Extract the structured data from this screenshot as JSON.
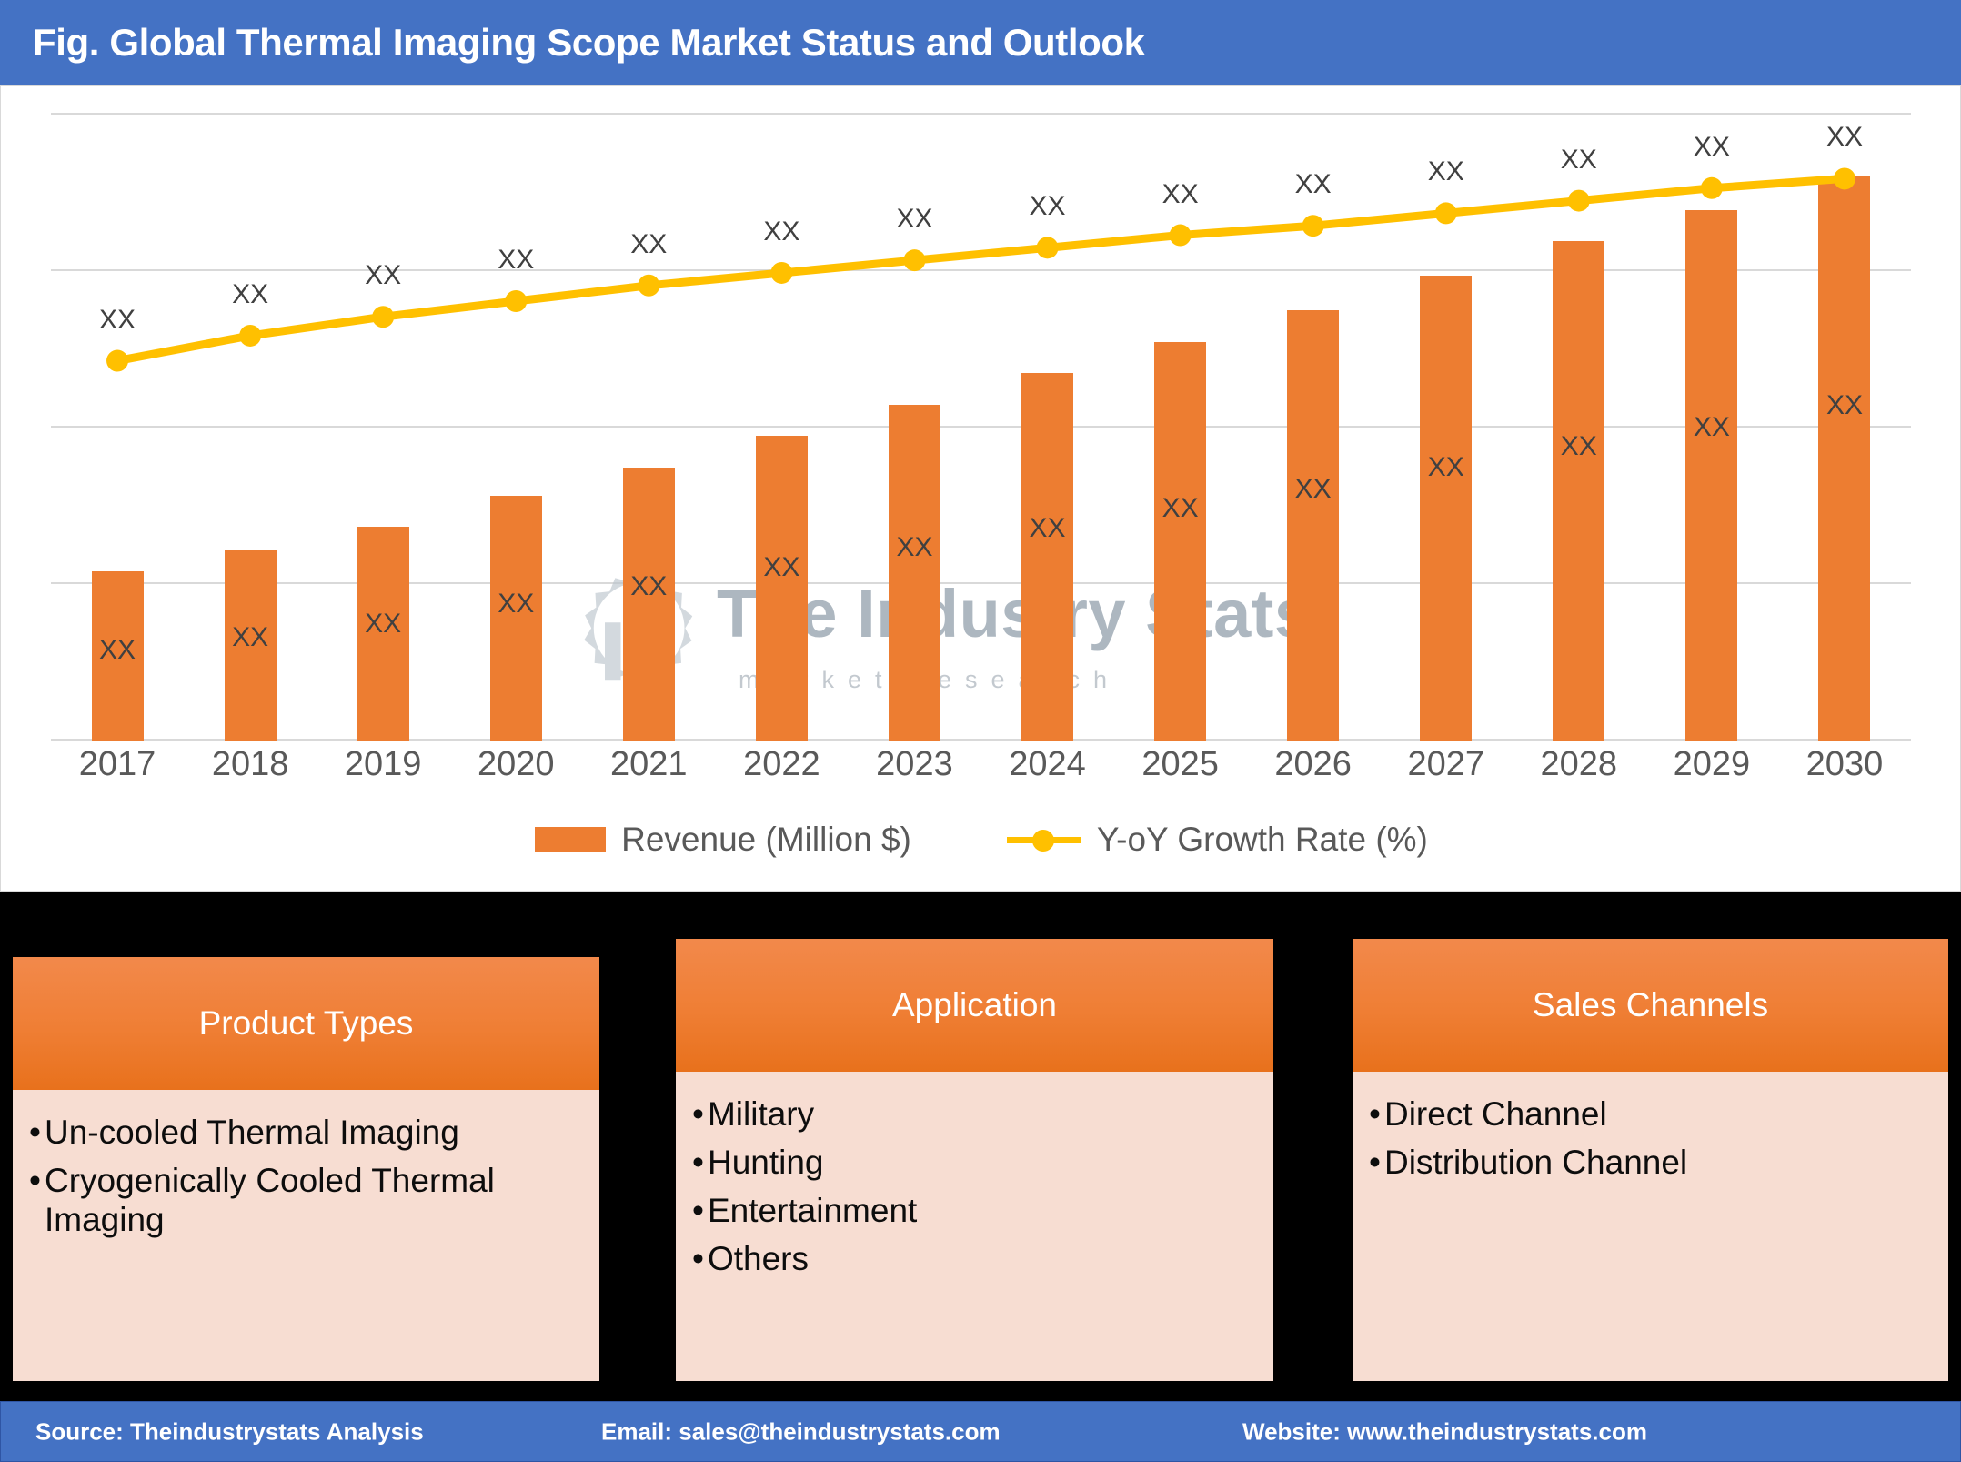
{
  "header": {
    "title": "Fig. Global Thermal Imaging Scope Market Status and Outlook",
    "background_color": "#4472C4"
  },
  "watermark": {
    "brand": "The Industry Stats",
    "tagline": "m a r k e t   r e s e a r c h",
    "logo_icon": "gear-building-wrench-icon"
  },
  "chart_data": {
    "type": "bar",
    "title": "Fig. Global Thermal Imaging Scope Market Status and Outlook",
    "xlabel": "",
    "ylabel": "",
    "grid": true,
    "gridline_count": 5,
    "legend_position": "bottom",
    "categories": [
      "2017",
      "2018",
      "2019",
      "2020",
      "2021",
      "2022",
      "2023",
      "2024",
      "2025",
      "2026",
      "2027",
      "2028",
      "2029",
      "2030"
    ],
    "series": [
      {
        "name": "Revenue (Million $)",
        "type": "bar",
        "color": "#ED7D31",
        "values": [
          27.0,
          30.5,
          34.0,
          39.0,
          43.5,
          48.5,
          53.5,
          58.5,
          63.5,
          68.5,
          74.0,
          79.5,
          84.5,
          90.0
        ],
        "value_labels": [
          "XX",
          "XX",
          "XX",
          "XX",
          "XX",
          "XX",
          "XX",
          "XX",
          "XX",
          "XX",
          "XX",
          "XX",
          "XX",
          "XX"
        ]
      },
      {
        "name": "Y-oY Growth Rate (%)",
        "type": "line",
        "color": "#FFC000",
        "values": [
          60.5,
          64.5,
          67.5,
          70.0,
          72.5,
          74.5,
          76.5,
          78.5,
          80.5,
          82.0,
          84.0,
          86.0,
          88.0,
          89.5
        ],
        "value_labels": [
          "XX",
          "XX",
          "XX",
          "XX",
          "XX",
          "XX",
          "XX",
          "XX",
          "XX",
          "XX",
          "XX",
          "XX",
          "XX",
          "XX"
        ]
      }
    ],
    "ylim": [
      0,
      100
    ]
  },
  "legend": [
    {
      "label": "Revenue (Million $)",
      "marker": "square",
      "color": "#ED7D31"
    },
    {
      "label": "Y-oY Growth Rate (%)",
      "marker": "line-dot",
      "color": "#FFC000"
    }
  ],
  "panels": [
    {
      "id": "product",
      "title": "Product Types",
      "items": [
        "Un-cooled Thermal Imaging",
        "Cryogenically Cooled Thermal Imaging"
      ]
    },
    {
      "id": "application",
      "title": "Application",
      "items": [
        "Military",
        "Hunting",
        "Entertainment",
        "Others"
      ]
    },
    {
      "id": "sales",
      "title": "Sales Channels",
      "items": [
        "Direct Channel",
        "Distribution Channel"
      ]
    }
  ],
  "footer": {
    "source": "Source: Theindustrystats Analysis",
    "email": "Email: sales@theindustrystats.com",
    "website": "Website: www.theindustrystats.com",
    "background_color": "#4472C4"
  }
}
